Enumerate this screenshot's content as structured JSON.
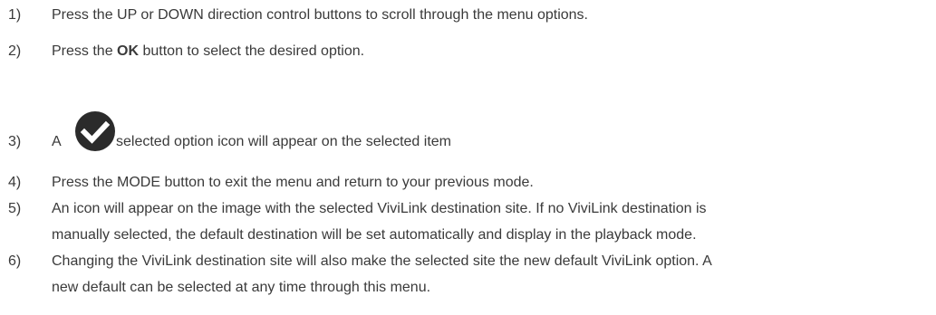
{
  "steps": [
    {
      "number": "1)",
      "text": "Press the UP or DOWN direction control buttons to scroll through the menu options."
    },
    {
      "number": "2)",
      "before": "Press the ",
      "bold": "OK",
      "after": " button to select the desired option."
    },
    {
      "number": "3)",
      "before": "A",
      "icon": "checkmark-circle-icon",
      "after": "selected option icon will appear on the selected item"
    },
    {
      "number": "4)",
      "text": "Press the MODE button to exit the menu and return to your previous mode."
    },
    {
      "number": "5)",
      "lines": [
        "An icon will appear on the image with the selected ViviLink destination site. If no ViviLink destination is",
        "manually selected, the default destination will be set automatically and display in the playback mode."
      ]
    },
    {
      "number": "6)",
      "lines": [
        "Changing the ViviLink destination site will also make the selected site the new default ViviLink option. A",
        "new default can be selected at any time through this menu."
      ]
    }
  ],
  "colors": {
    "text": "#3a3a3a",
    "icon": "#2b2b2b"
  }
}
